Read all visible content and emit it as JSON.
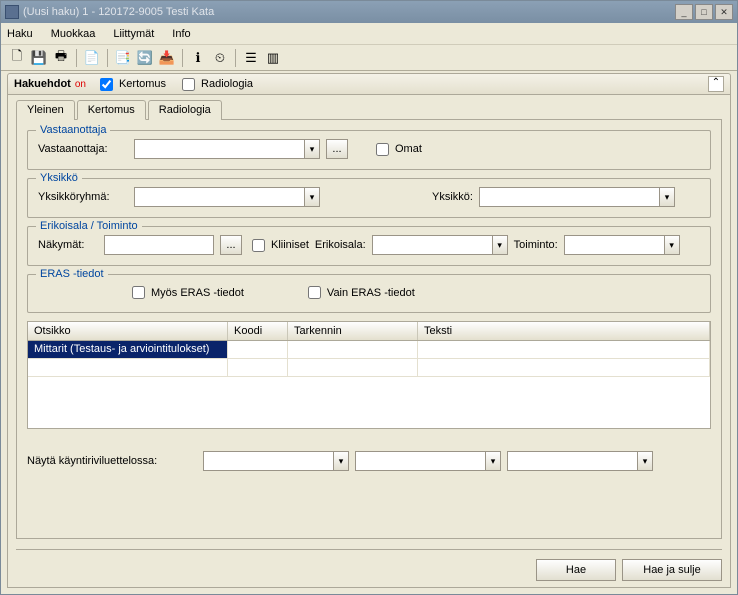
{
  "window": {
    "title": "(Uusi haku) 1 - 120172-9005 Testi Kata"
  },
  "menu": {
    "haku": "Haku",
    "muokkaa": "Muokkaa",
    "liittymat": "Liittymät",
    "info": "Info"
  },
  "toolbar_icons": {
    "new": "🗋",
    "save": "💾",
    "print": "🖶",
    "copy": "📄",
    "tool1": "📑",
    "tool2": "🔄",
    "tool3": "📥",
    "info": "ℹ",
    "clock": "⏲",
    "list": "☰",
    "columns": "▥"
  },
  "panel": {
    "title": "Hakuehdot",
    "on": "on",
    "chk_kertomus": "Kertomus",
    "chk_radiologia": "Radiologia"
  },
  "tabs": {
    "yleinen": "Yleinen",
    "kertomus": "Kertomus",
    "radiologia": "Radiologia"
  },
  "groups": {
    "vastaanottaja": {
      "legend": "Vastaanottaja",
      "label": "Vastaanottaja:",
      "omat": "Omat"
    },
    "yksikko": {
      "legend": "Yksikkö",
      "ryhma_label": "Yksikköryhmä:",
      "yksikko_label": "Yksikkö:"
    },
    "erikoisala": {
      "legend": "Erikoisala / Toiminto",
      "nakymat": "Näkymät:",
      "kliiniset": "Kliiniset",
      "erikoisala": "Erikoisala:",
      "toiminto": "Toiminto:"
    },
    "eras": {
      "legend": "ERAS -tiedot",
      "myos": "Myös ERAS -tiedot",
      "vain": "Vain ERAS -tiedot"
    }
  },
  "table": {
    "headers": {
      "otsikko": "Otsikko",
      "koodi": "Koodi",
      "tarkennin": "Tarkennin",
      "teksti": "Teksti"
    },
    "rows": [
      {
        "otsikko": "Mittarit (Testaus- ja arviointitulokset)",
        "koodi": "",
        "tarkennin": "",
        "teksti": ""
      },
      {
        "otsikko": "",
        "koodi": "",
        "tarkennin": "",
        "teksti": ""
      }
    ]
  },
  "bottom": {
    "label": "Näytä käyntiriviluettelossa:"
  },
  "buttons": {
    "hae": "Hae",
    "hae_sulje": "Hae ja sulje",
    "ellipsis": "..."
  }
}
